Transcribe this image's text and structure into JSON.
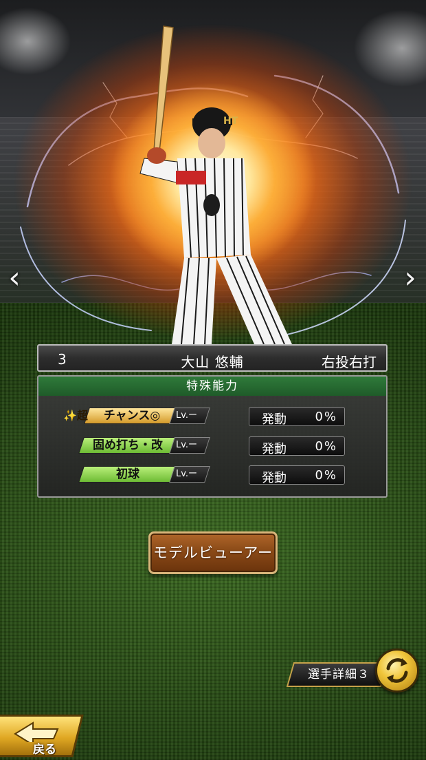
{
  "player": {
    "number": "3",
    "name": "大山 悠輔",
    "throws_bats": "右投右打",
    "jersey_number": "3"
  },
  "special_abilities": {
    "header": "特殊能力",
    "items": [
      {
        "prefix": "✨超",
        "label": "チャンス◎",
        "level": "Lv.ー",
        "activation_label": "発動",
        "activation_rate": "0%",
        "color": "#e7b94a"
      },
      {
        "prefix": "",
        "label": "固め打ち・改",
        "level": "Lv.ー",
        "activation_label": "発動",
        "activation_rate": "0%",
        "color": "#8fd14f"
      },
      {
        "prefix": "",
        "label": "初球",
        "level": "Lv.ー",
        "activation_label": "発動",
        "activation_rate": "0%",
        "color": "#8fd14f"
      }
    ]
  },
  "buttons": {
    "model_viewer": "モデルビューアー",
    "player_detail": "選手詳細３",
    "back": "戻る"
  },
  "navigation": {
    "prev_arrow": "‹",
    "next_arrow": "›"
  },
  "icons": {
    "swap": "swap-arrows-icon",
    "back": "back-arrow-icon"
  },
  "colors": {
    "panel_header": "#2f7a3a",
    "button_brown": "#8a4a17",
    "gold": "#e0a823"
  }
}
